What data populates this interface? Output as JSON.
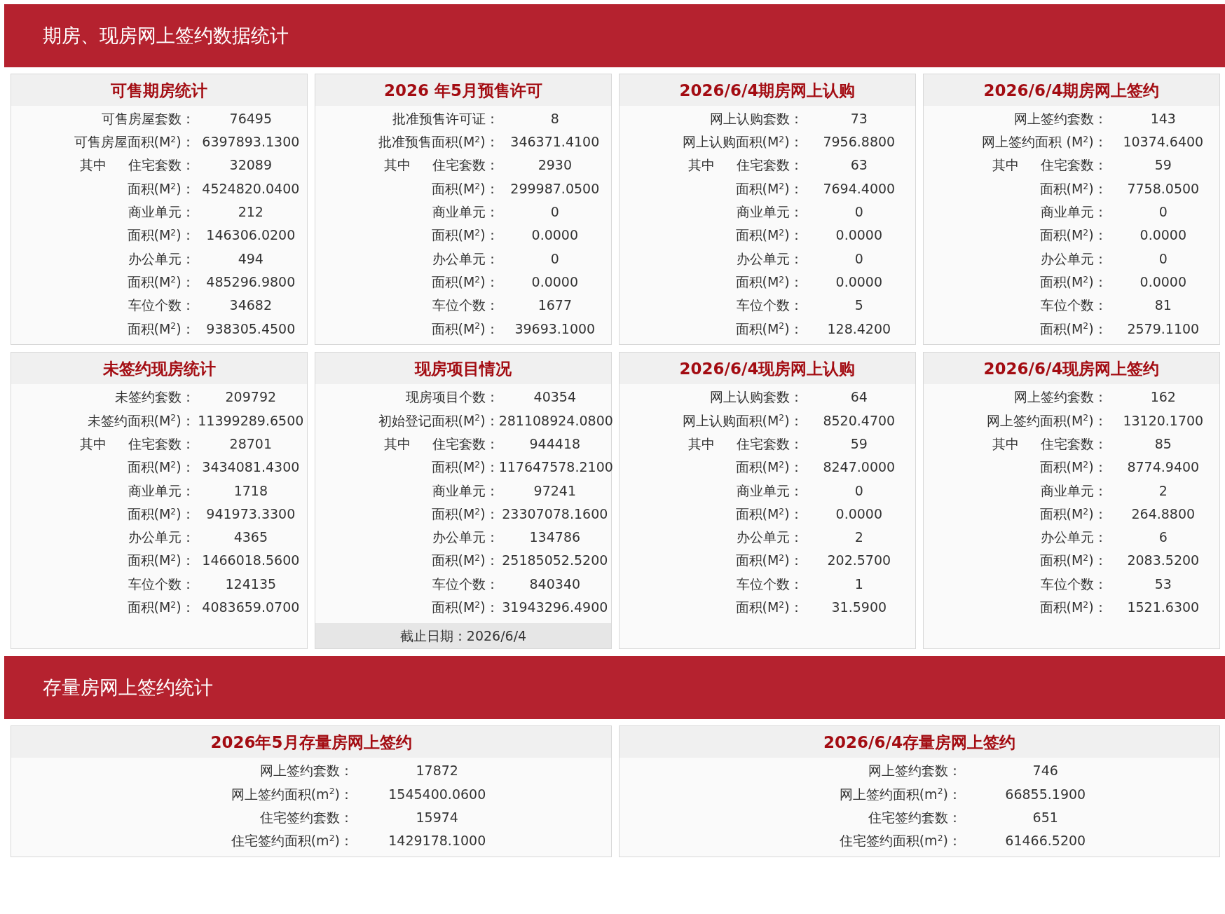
{
  "sections": [
    {
      "title": "期房、现房网上签约数据统计",
      "panels": [
        {
          "title": "可售期房统计",
          "rows": [
            {
              "label": "可售房屋套数：",
              "value": "76495"
            },
            {
              "label": "可售房屋面积(M$^{2}$)：",
              "value": "6397893.1300"
            },
            {
              "group": "其中",
              "label": "住宅套数：",
              "value": "32089"
            },
            {
              "label": "面积(M$^{2}$)：",
              "value": "4524820.0400"
            },
            {
              "label": "商业单元：",
              "value": "212"
            },
            {
              "label": "面积(M$^{2}$)：",
              "value": "146306.0200"
            },
            {
              "label": "办公单元：",
              "value": "494"
            },
            {
              "label": "面积(M$^{2}$)：",
              "value": "485296.9800"
            },
            {
              "label": "车位个数：",
              "value": "34682"
            },
            {
              "label": "面积(M$^{2}$)：",
              "value": "938305.4500"
            }
          ]
        },
        {
          "title": "2026 年5月预售许可",
          "rows": [
            {
              "label": "批准预售许可证：",
              "value": "8"
            },
            {
              "label": "批准预售面积(M$^{2}$)：",
              "value": "346371.4100"
            },
            {
              "group": "其中",
              "label": "住宅套数：",
              "value": "2930"
            },
            {
              "label": "面积(M$^{2}$)：",
              "value": "299987.0500"
            },
            {
              "label": "商业单元：",
              "value": "0"
            },
            {
              "label": "面积(M$^{2}$)：",
              "value": "0.0000"
            },
            {
              "label": "办公单元：",
              "value": "0"
            },
            {
              "label": "面积(M$^{2}$)：",
              "value": "0.0000"
            },
            {
              "label": "车位个数：",
              "value": "1677"
            },
            {
              "label": "面积(M$^{2}$)：",
              "value": "39693.1000"
            }
          ]
        },
        {
          "title": "2026/6/4期房网上认购",
          "rows": [
            {
              "label": "网上认购套数：",
              "value": "73"
            },
            {
              "label": "网上认购面积(M$^{2}$)：",
              "value": "7956.8800"
            },
            {
              "group": "其中",
              "label": "住宅套数：",
              "value": "63"
            },
            {
              "label": "面积(M$^{2}$)：",
              "value": "7694.4000"
            },
            {
              "label": "商业单元：",
              "value": "0"
            },
            {
              "label": "面积(M$^{2}$)：",
              "value": "0.0000"
            },
            {
              "label": "办公单元：",
              "value": "0"
            },
            {
              "label": "面积(M$^{2}$)：",
              "value": "0.0000"
            },
            {
              "label": "车位个数：",
              "value": "5"
            },
            {
              "label": "面积(M$^{2}$)：",
              "value": "128.4200"
            }
          ]
        },
        {
          "title": "2026/6/4期房网上签约",
          "rows": [
            {
              "label": "网上签约套数：",
              "value": "143"
            },
            {
              "label": "网上签约面积 (M$^{2}$)：",
              "value": "10374.6400"
            },
            {
              "group": "其中",
              "label": "住宅套数：",
              "value": "59"
            },
            {
              "label": "面积(M$^{2}$)：",
              "value": "7758.0500"
            },
            {
              "label": "商业单元：",
              "value": "0"
            },
            {
              "label": "面积(M$^{2}$)：",
              "value": "0.0000"
            },
            {
              "label": "办公单元：",
              "value": "0"
            },
            {
              "label": "面积(M$^{2}$)：",
              "value": "0.0000"
            },
            {
              "label": "车位个数：",
              "value": "81"
            },
            {
              "label": "面积(M$^{2}$)：",
              "value": "2579.1100"
            }
          ]
        },
        {
          "title": "未签约现房统计",
          "rows": [
            {
              "label": "未签约套数：",
              "value": "209792"
            },
            {
              "label": "未签约面积(M$^{2}$)：",
              "value": "11399289.6500"
            },
            {
              "group": "其中",
              "label": "住宅套数：",
              "value": "28701"
            },
            {
              "label": "面积(M$^{2}$)：",
              "value": "3434081.4300"
            },
            {
              "label": "商业单元：",
              "value": "1718"
            },
            {
              "label": "面积(M$^{2}$)：",
              "value": "941973.3300"
            },
            {
              "label": "办公单元：",
              "value": "4365"
            },
            {
              "label": "面积(M$^{2}$)：",
              "value": "1466018.5600"
            },
            {
              "label": "车位个数：",
              "value": "124135"
            },
            {
              "label": "面积(M$^{2}$)：",
              "value": "4083659.0700"
            }
          ]
        },
        {
          "title": "现房项目情况",
          "rows": [
            {
              "label": "现房项目个数：",
              "value": "40354"
            },
            {
              "label": "初始登记面积(M$^{2}$)：",
              "value": "281108924.0800"
            },
            {
              "group": "其中",
              "label": "住宅套数：",
              "value": "944418"
            },
            {
              "label": "面积(M$^{2}$)：",
              "value": "117647578.2100"
            },
            {
              "label": "商业单元：",
              "value": "97241"
            },
            {
              "label": "面积(M$^{2}$)：",
              "value": "23307078.1600"
            },
            {
              "label": "办公单元：",
              "value": "134786"
            },
            {
              "label": "面积(M$^{2}$)：",
              "value": "25185052.5200"
            },
            {
              "label": "车位个数：",
              "value": "840340"
            },
            {
              "label": "面积(M$^{2}$)：",
              "value": "31943296.4900"
            }
          ],
          "footer": "截止日期：2026/6/4"
        },
        {
          "title": "2026/6/4现房网上认购",
          "rows": [
            {
              "label": "网上认购套数：",
              "value": "64"
            },
            {
              "label": "网上认购面积(M$^{2}$)：",
              "value": "8520.4700"
            },
            {
              "group": "其中",
              "label": "住宅套数：",
              "value": "59"
            },
            {
              "label": "面积(M$^{2}$)：",
              "value": "8247.0000"
            },
            {
              "label": "商业单元：",
              "value": "0"
            },
            {
              "label": "面积(M$^{2}$)：",
              "value": "0.0000"
            },
            {
              "label": "办公单元：",
              "value": "2"
            },
            {
              "label": "面积(M$^{2}$)：",
              "value": "202.5700"
            },
            {
              "label": "车位个数：",
              "value": "1"
            },
            {
              "label": "面积(M$^{2}$)：",
              "value": "31.5900"
            }
          ]
        },
        {
          "title": "2026/6/4现房网上签约",
          "rows": [
            {
              "label": "网上签约套数：",
              "value": "162"
            },
            {
              "label": "网上签约面积(M$^{2}$)：",
              "value": "13120.1700"
            },
            {
              "group": "其中",
              "label": "住宅套数：",
              "value": "85"
            },
            {
              "label": "面积(M$^{2}$)：",
              "value": "8774.9400"
            },
            {
              "label": "商业单元：",
              "value": "2"
            },
            {
              "label": "面积(M$^{2}$)：",
              "value": "264.8800"
            },
            {
              "label": "办公单元：",
              "value": "6"
            },
            {
              "label": "面积(M$^{2}$)：",
              "value": "2083.5200"
            },
            {
              "label": "车位个数：",
              "value": "53"
            },
            {
              "label": "面积(M$^{2}$)：",
              "value": "1521.6300"
            }
          ]
        }
      ]
    },
    {
      "title": "存量房网上签约统计",
      "panels": [
        {
          "title": "2026年5月存量房网上签约",
          "rows": [
            {
              "label": "网上签约套数：",
              "value": "17872"
            },
            {
              "label": "网上签约面积(m$^{2}$)：",
              "value": "1545400.0600"
            },
            {
              "label": "住宅签约套数：",
              "value": "15974"
            },
            {
              "label": "住宅签约面积(m$^{2}$)：",
              "value": "1429178.1000"
            }
          ]
        },
        {
          "title": "2026/6/4存量房网上签约",
          "rows": [
            {
              "label": "网上签约套数：",
              "value": "746"
            },
            {
              "label": "网上签约面积(m$^{2}$)：",
              "value": "66855.1900"
            },
            {
              "label": "住宅签约套数：",
              "value": "651"
            },
            {
              "label": "住宅签约面积(m$^{2}$)：",
              "value": "61466.5200"
            }
          ]
        }
      ]
    }
  ]
}
